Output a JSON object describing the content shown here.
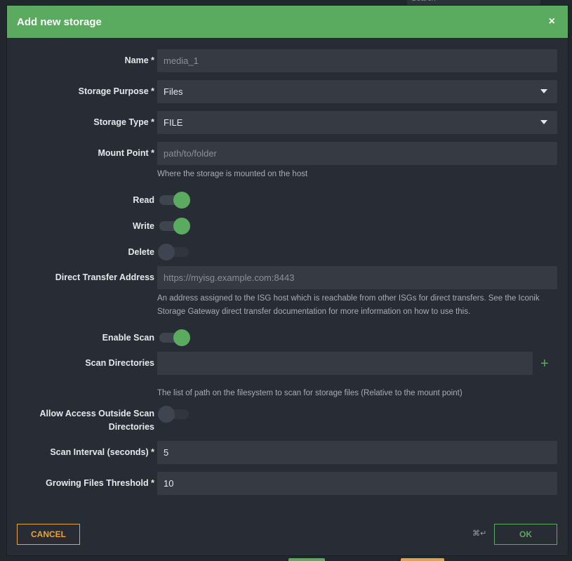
{
  "background": {
    "search_placeholder": "Search"
  },
  "modal": {
    "title": "Add new storage",
    "close_glyph": "×",
    "fields": {
      "name": {
        "label": "Name *",
        "value": "media_1"
      },
      "storage_purpose": {
        "label": "Storage Purpose *",
        "value": "Files"
      },
      "storage_type": {
        "label": "Storage Type *",
        "value": "FILE"
      },
      "mount_point": {
        "label": "Mount Point *",
        "placeholder": "path/to/folder",
        "help": "Where the storage is mounted on the host"
      },
      "read": {
        "label": "Read",
        "on": true
      },
      "write": {
        "label": "Write",
        "on": true
      },
      "delete": {
        "label": "Delete",
        "on": false
      },
      "direct_transfer_address": {
        "label": "Direct Transfer Address",
        "placeholder": "https://myisg.example.com:8443",
        "help": "An address assigned to the ISG host which is reachable from other ISGs for direct transfers. See the Iconik Storage Gateway direct transfer documentation for more information on how to use this."
      },
      "enable_scan": {
        "label": "Enable Scan",
        "on": true
      },
      "scan_directories": {
        "label": "Scan Directories",
        "value": "",
        "add_glyph": "+",
        "help": "The list of path on the filesystem to scan for storage files (Relative to the mount point)"
      },
      "allow_access_outside": {
        "label": "Allow Access Outside Scan Directories",
        "on": false
      },
      "scan_interval": {
        "label": "Scan Interval (seconds) *",
        "value": "5"
      },
      "growing_files_threshold": {
        "label": "Growing Files Threshold *",
        "value": "10"
      }
    },
    "footer": {
      "cancel_label": "CANCEL",
      "shortcut_hint": "⌘↵",
      "ok_label": "OK"
    }
  },
  "colors": {
    "header": "#5aaa5f",
    "accent_green": "#5aaa5f",
    "cancel_orange": "#e8a33c",
    "modal_bg": "#282c34",
    "input_bg": "#353a43"
  }
}
